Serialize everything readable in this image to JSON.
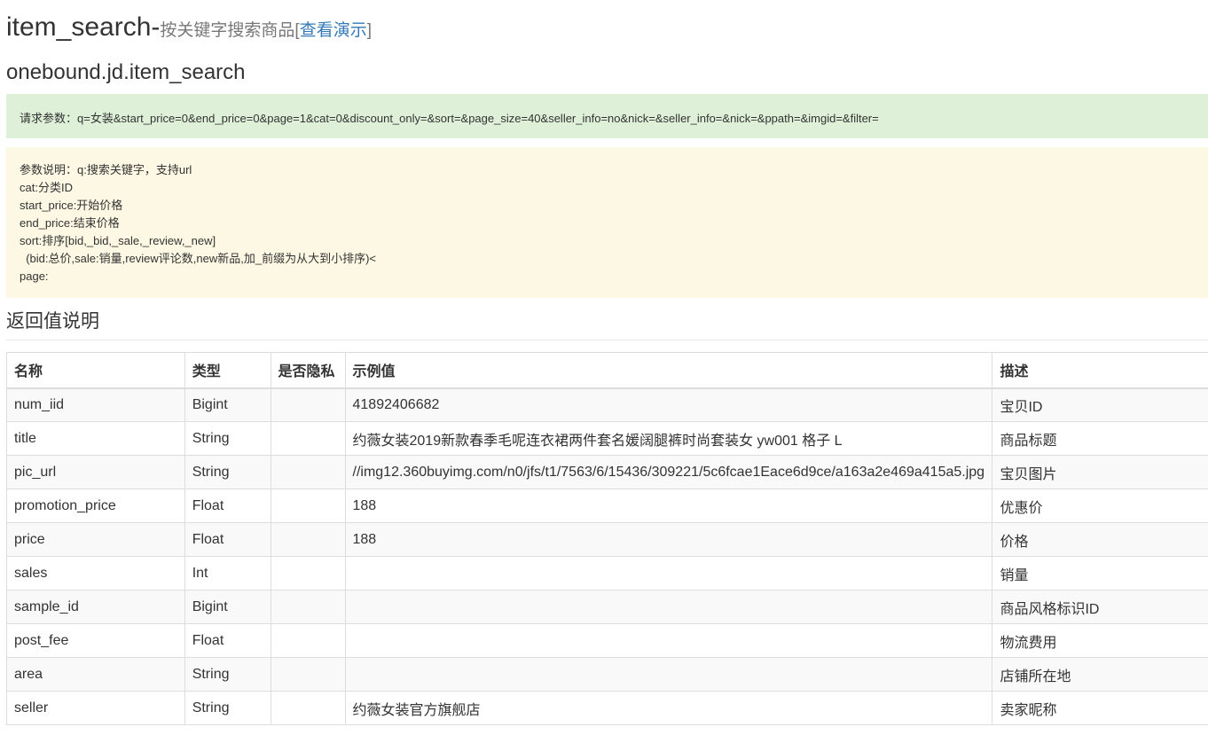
{
  "header": {
    "title_main": "item_search-",
    "title_sub": "按关键字搜索商品[",
    "demo_link": "查看演示",
    "title_close": "]",
    "api_name": "onebound.jd.item_search"
  },
  "request": {
    "text": "请求参数：q=女装&start_price=0&end_price=0&page=1&cat=0&discount_only=&sort=&page_size=40&seller_info=no&nick=&seller_info=&nick=&ppath=&imgid=&filter="
  },
  "params": {
    "lines": [
      "参数说明：q:搜索关键字，支持url",
      "cat:分类ID",
      "start_price:开始价格",
      "end_price:结束价格",
      "sort:排序[bid,_bid,_sale,_review,_new]",
      "  (bid:总价,sale:销量,review评论数,new新品,加_前缀为从大到小排序)<",
      "page:"
    ]
  },
  "return_section": {
    "heading": "返回值说明",
    "columns": [
      "名称",
      "类型",
      "是否隐私",
      "示例值",
      "描述"
    ],
    "rows": [
      [
        "num_iid",
        "Bigint",
        "",
        "41892406682",
        "宝贝ID"
      ],
      [
        "title",
        "String",
        "",
        "约薇女装2019新款春季毛呢连衣裙两件套名媛阔腿裤时尚套装女 yw001 格子 L",
        "商品标题"
      ],
      [
        "pic_url",
        "String",
        "",
        "//img12.360buyimg.com/n0/jfs/t1/7563/6/15436/309221/5c6fcae1Eace6d9ce/a163a2e469a415a5.jpg",
        "宝贝图片"
      ],
      [
        "promotion_price",
        "Float",
        "",
        "188",
        "优惠价"
      ],
      [
        "price",
        "Float",
        "",
        "188",
        "价格"
      ],
      [
        "sales",
        "Int",
        "",
        "",
        "销量"
      ],
      [
        "sample_id",
        "Bigint",
        "",
        "",
        "商品风格标识ID"
      ],
      [
        "post_fee",
        "Float",
        "",
        "",
        "物流费用"
      ],
      [
        "area",
        "String",
        "",
        "",
        "店铺所在地"
      ],
      [
        "seller",
        "String",
        "",
        "约薇女装官方旗舰店",
        "卖家昵称"
      ]
    ]
  }
}
